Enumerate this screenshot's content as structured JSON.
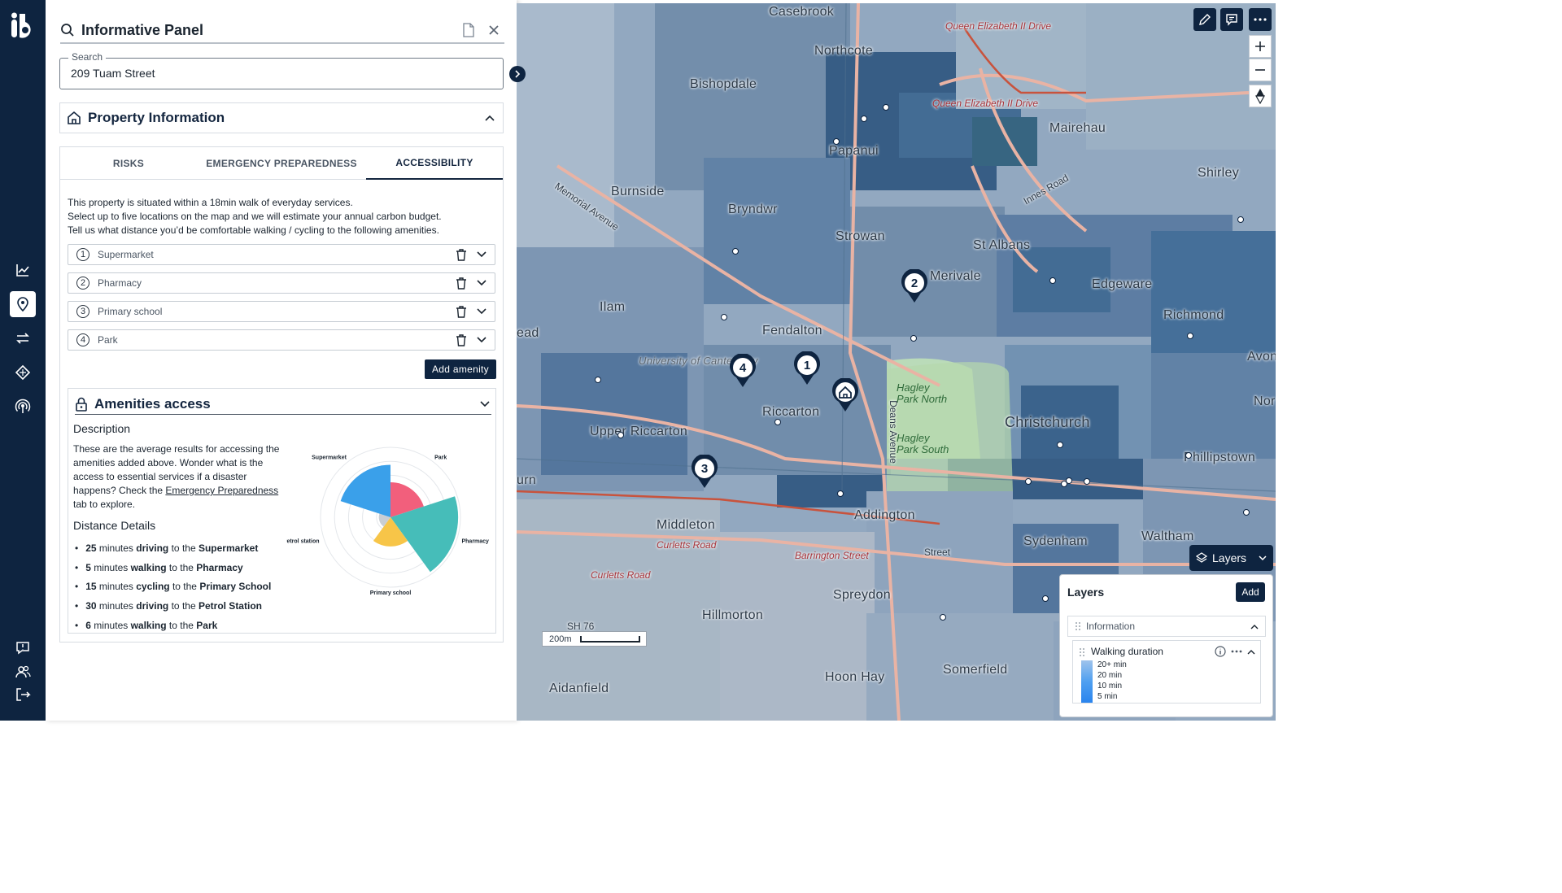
{
  "rail": {
    "items": [
      "chart-icon",
      "map-pin-icon",
      "transfer-icon",
      "diamond-icon",
      "broadcast-icon"
    ],
    "bottom_items": [
      "feedback-icon",
      "users-icon",
      "logout-icon"
    ],
    "active": "map-pin-icon"
  },
  "panel": {
    "title": "Informative Panel",
    "search": {
      "legend": "Search",
      "value": "209 Tuam Street"
    },
    "property_section": "Property Information",
    "tabs": [
      "RISKS",
      "EMERGENCY PREPAREDNESS",
      "ACCESSIBILITY"
    ],
    "active_tab": "ACCESSIBILITY",
    "intro_lines": [
      "This property is situated within a 18min walk of everyday services.",
      "Select up to five locations on the map and we will estimate your annual carbon budget.",
      "Tell us what distance you’d be comfortable walking / cycling to the following amenities."
    ],
    "amenities": [
      {
        "num": "1",
        "name": "Supermarket"
      },
      {
        "num": "2",
        "name": "Pharmacy"
      },
      {
        "num": "3",
        "name": "Primary school"
      },
      {
        "num": "4",
        "name": "Park"
      }
    ],
    "add_amenity": "Add amenity",
    "access": {
      "title": "Amenities access",
      "description_title": "Description",
      "description_before": "These are the average results for accessing the amenities added above. Wonder what is the access to essential services if a disaster happens? Check the ",
      "description_link": "Emergency Preparedness",
      "description_after": " tab to explore.",
      "distance_title": "Distance Details",
      "details": [
        {
          "num": "25",
          "mid1": " minutes ",
          "mode": "driving",
          "mid2": " to the ",
          "dest": "Supermarket"
        },
        {
          "num": "5",
          "mid1": " minutes ",
          "mode": "walking",
          "mid2": " to the ",
          "dest": "Pharmacy"
        },
        {
          "num": "15",
          "mid1": " minutes ",
          "mode": "cycling",
          "mid2": " to the ",
          "dest": "Primary School"
        },
        {
          "num": "30",
          "mid1": " minutes ",
          "mode": "driving",
          "mid2": " to the ",
          "dest": "Petrol Station"
        },
        {
          "num": "6",
          "mid1": " minutes ",
          "mode": "walking",
          "mid2": " to the ",
          "dest": "Park"
        }
      ]
    }
  },
  "chart_data": {
    "type": "polar-area",
    "categories": [
      "Park",
      "Pharmacy",
      "Primary school",
      "Petrol station",
      "Supermarket"
    ],
    "values": [
      30,
      58,
      25,
      10,
      45
    ],
    "colors": [
      "#f25f7c",
      "#46bdb9",
      "#f7c548",
      "#c9ced4",
      "#3aa0ea"
    ],
    "grid": true
  },
  "map": {
    "labels": [
      "Casebrook",
      "Northcote",
      "Bishopdale",
      "Papanui",
      "Mairehau",
      "Shirley",
      "Burnside",
      "Bryndwr",
      "Strowan",
      "St Albans",
      "Edgeware",
      "Ilam",
      "Fendalton",
      "Merivale",
      "Richmond",
      "Avon",
      "University of Canterbury",
      "Riccarton",
      "Upper Riccarton",
      "Christchurch",
      "Phillipstown",
      "Middleton",
      "Addington",
      "Sydenham",
      "Waltham",
      "Spreydon",
      "Hillmorton",
      "Somerfield",
      "Hoon Hay",
      "Aidanfield",
      "Nor",
      "urn",
      "ead"
    ],
    "road_labels": [
      "Queen Elizabeth II Drive",
      "Queen Elizabeth II Drive",
      "Curletts Road",
      "Curletts Road",
      "Barrington Street",
      "Street",
      "SH 76",
      "Memorial Avenue",
      "Innes Road",
      "Deans Avenue"
    ],
    "park_labels": [
      "Hagley Park North",
      "Hagley Park South"
    ],
    "pins": [
      "1",
      "2",
      "3",
      "4"
    ],
    "scale": "200m"
  },
  "layers": {
    "button": "Layers",
    "panel_title": "Layers",
    "add": "Add",
    "group": "Information",
    "layer_name": "Walking duration",
    "legend": [
      "20+ min",
      "20 min",
      "10 min",
      "5 min"
    ]
  }
}
